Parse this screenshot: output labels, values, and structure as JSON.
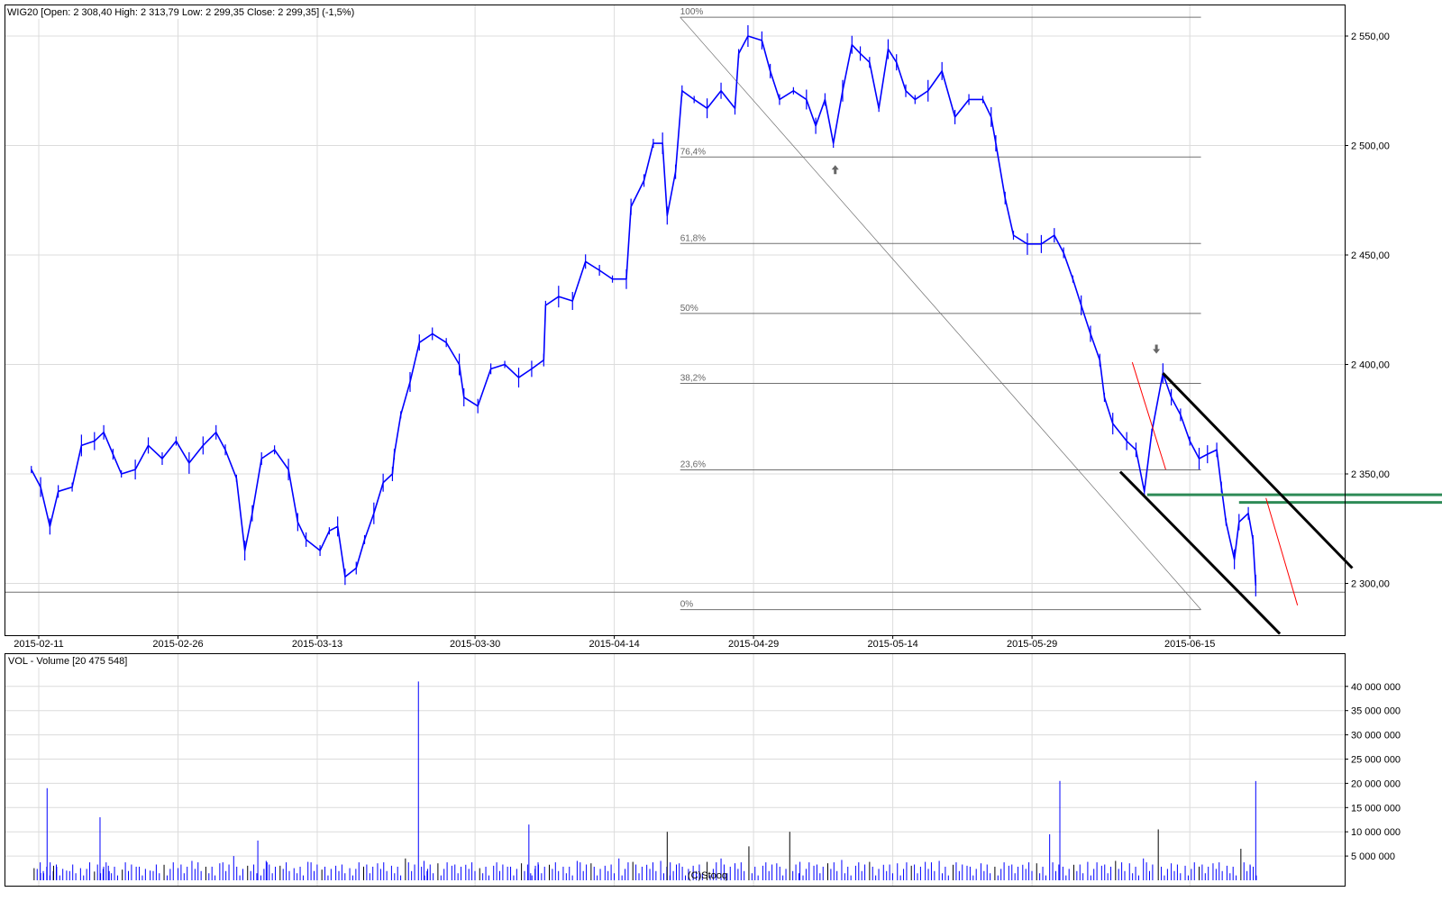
{
  "header": {
    "title": "WIG20 [Open: 2 308,40  High: 2 313,79  Low: 2 299,35  Close: 2 299,35] (-1,5%)"
  },
  "volume_header": {
    "title": "VOL - Volume [20 475 548]"
  },
  "footer": {
    "copyright": "(C)Stooq"
  },
  "colors": {
    "price": "#0000ff",
    "volume": "#0000ff",
    "grid": "#dcdcdc",
    "fib": "#707070",
    "channel": "#000000",
    "support": "#2e8b57",
    "trend": "#ff0000"
  },
  "chart_data": [
    {
      "type": "line",
      "title": "WIG20",
      "x_unit": "days since 2015-02-11",
      "xlim": [
        -3.7,
        140.7
      ],
      "ylim": [
        2281,
        2563
      ],
      "grid": true,
      "x_ticks": [
        {
          "day": 0,
          "label": "2015-02-11"
        },
        {
          "day": 15,
          "label": "2015-02-26"
        },
        {
          "day": 30,
          "label": "2015-03-13"
        },
        {
          "day": 47,
          "label": "2015-03-30"
        },
        {
          "day": 62,
          "label": "2015-04-14"
        },
        {
          "day": 77,
          "label": "2015-04-29"
        },
        {
          "day": 92,
          "label": "2015-05-14"
        },
        {
          "day": 107,
          "label": "2015-05-29"
        },
        {
          "day": 124,
          "label": "2015-06-15"
        }
      ],
      "y_ticks": [
        {
          "value": 2300,
          "label": "2 300,00"
        },
        {
          "value": 2350,
          "label": "2 350,00"
        },
        {
          "value": 2400,
          "label": "2 400,00"
        },
        {
          "value": 2450,
          "label": "2 450,00"
        },
        {
          "value": 2500,
          "label": "2 500,00"
        },
        {
          "value": 2550,
          "label": "2 550,00"
        }
      ],
      "series": [
        {
          "name": "WIG20",
          "days": [
            -0.8,
            0.2,
            1.2,
            2.1,
            3.6,
            4.6,
            6.0,
            7.0,
            8.0,
            8.9,
            10.4,
            11.8,
            13.3,
            14.8,
            16.2,
            17.7,
            19.1,
            20.1,
            21.3,
            22.2,
            23.0,
            24.0,
            25.4,
            26.9,
            27.9,
            28.8,
            30.3,
            31.3,
            32.2,
            33.0,
            34.2,
            35.1,
            36.1,
            37.1,
            38.1,
            38.3,
            39.0,
            40.0,
            41.0,
            42.4,
            43.9,
            45.3,
            45.8,
            47.3,
            48.7,
            50.2,
            51.7,
            53.1,
            54.4,
            54.6,
            56.0,
            57.5,
            58.9,
            60.4,
            61.8,
            63.3,
            63.8,
            65.2,
            66.2,
            67.2,
            67.7,
            68.6,
            69.3,
            70.6,
            72.0,
            73.5,
            75.0,
            75.4,
            76.4,
            77.9,
            78.8,
            79.8,
            81.3,
            82.7,
            83.7,
            84.7,
            85.6,
            86.6,
            87.6,
            88.5,
            89.5,
            90.5,
            91.5,
            92.4,
            93.4,
            94.4,
            95.8,
            97.3,
            98.7,
            100.2,
            101.7,
            102.6,
            103.1,
            104.1,
            105.0,
            106.5,
            108.0,
            109.4,
            110.4,
            111.4,
            112.3,
            113.3,
            114.3,
            114.8,
            115.7,
            117.2,
            118.2,
            119.1,
            119.9,
            121.1,
            122.0,
            123.0,
            124.0,
            125.0,
            125.9,
            126.9,
            127.4,
            127.9,
            128.8,
            129.3,
            130.3,
            130.8,
            131.1
          ],
          "values": [
            2352,
            2344,
            2326,
            2342,
            2344,
            2363,
            2365,
            2369,
            2359,
            2350,
            2352,
            2363,
            2357,
            2365,
            2355,
            2363,
            2369,
            2361,
            2348,
            2315,
            2332,
            2357,
            2361,
            2352,
            2328,
            2320,
            2315,
            2324,
            2326,
            2303,
            2307,
            2320,
            2332,
            2346,
            2350,
            2359,
            2377,
            2392,
            2410,
            2414,
            2410,
            2400,
            2385,
            2381,
            2398,
            2400,
            2394,
            2398,
            2402,
            2427,
            2431,
            2429,
            2447,
            2443,
            2439,
            2439,
            2472,
            2484,
            2501,
            2501,
            2468,
            2488,
            2525,
            2521,
            2517,
            2525,
            2517,
            2542,
            2550,
            2548,
            2534,
            2521,
            2525,
            2521,
            2509,
            2521,
            2501,
            2525,
            2546,
            2542,
            2538,
            2517,
            2544,
            2538,
            2525,
            2521,
            2525,
            2534,
            2513,
            2521,
            2521,
            2513,
            2501,
            2476,
            2459,
            2455,
            2455,
            2459,
            2451,
            2439,
            2427,
            2414,
            2402,
            2385,
            2373,
            2365,
            2361,
            2342,
            2369,
            2396,
            2385,
            2377,
            2365,
            2357,
            2359,
            2361,
            2344,
            2328,
            2311,
            2328,
            2332,
            2320,
            2299
          ]
        }
      ],
      "annotations": {
        "fibonacci": {
          "start_day": 69.1,
          "end_day": 125.2,
          "high": 2558.6,
          "low": 2288,
          "levels": [
            {
              "ratio": 1.0,
              "label": "100%"
            },
            {
              "ratio": 0.764,
              "label": "76,4%"
            },
            {
              "ratio": 0.618,
              "label": "61,8%"
            },
            {
              "ratio": 0.5,
              "label": "50%"
            },
            {
              "ratio": 0.382,
              "label": "38,2%"
            },
            {
              "ratio": 0.236,
              "label": "23,6%"
            },
            {
              "ratio": 0.0,
              "label": "0%"
            }
          ]
        },
        "horizontal_support": 2296,
        "green_levels": [
          {
            "from_day": 119.4,
            "price": 2340.5
          },
          {
            "from_day": 129.3,
            "price": 2337
          }
        ],
        "channel_lines": [
          {
            "from": [
              121.1,
              2396
            ],
            "to": [
              141.5,
              2307
            ]
          },
          {
            "from": [
              116.5,
              2351
            ],
            "to": [
              133.7,
              2277
            ]
          }
        ],
        "red_lines": [
          {
            "from": [
              117.8,
              2401
            ],
            "to": [
              121.4,
              2352
            ]
          },
          {
            "from": [
              132.2,
              2339
            ],
            "to": [
              135.6,
              2290
            ]
          }
        ],
        "arrows": [
          {
            "direction": "up",
            "day": 85.8,
            "price": 2489
          },
          {
            "direction": "down",
            "day": 120.4,
            "price": 2407
          }
        ]
      }
    },
    {
      "type": "bar",
      "title": "VOL - Volume",
      "ylim": [
        0,
        42000000
      ],
      "y_ticks": [
        {
          "value": 5000000,
          "label": "5 000 000"
        },
        {
          "value": 10000000,
          "label": "10 000 000"
        },
        {
          "value": 15000000,
          "label": "15 000 000"
        },
        {
          "value": 20000000,
          "label": "20 000 000"
        },
        {
          "value": 25000000,
          "label": "25 000 000"
        },
        {
          "value": 30000000,
          "label": "30 000 000"
        },
        {
          "value": 35000000,
          "label": "35 000 000"
        },
        {
          "value": 40000000,
          "label": "40 000 000"
        }
      ],
      "days": [
        -0.5,
        0.2,
        0.9,
        1.6,
        3,
        4.5,
        6,
        6.6,
        7.5,
        9,
        10.5,
        12,
        13.5,
        15,
        16.5,
        18,
        19.5,
        21,
        22.5,
        23.6,
        24.5,
        26,
        27.5,
        29,
        30.5,
        32,
        33.5,
        35,
        36.5,
        38,
        39.5,
        40.9,
        41.5,
        43,
        44.5,
        46,
        47.5,
        49,
        50.5,
        52,
        52.8,
        53.5,
        55,
        56.5,
        58,
        59.5,
        61,
        62.5,
        64,
        65.5,
        67,
        67.7,
        69,
        70.5,
        72,
        73.5,
        75,
        76.5,
        78,
        79.5,
        80.9,
        82,
        83.5,
        85,
        86.5,
        88,
        89.5,
        91,
        92.5,
        94,
        95.5,
        97,
        98.5,
        100,
        101.5,
        103,
        104.5,
        106,
        107.5,
        108.9,
        110,
        111.5,
        113,
        114.5,
        116,
        117.5,
        119,
        120.6,
        122,
        123.5,
        125,
        126.5,
        128,
        129.5,
        130.5,
        131.1
      ],
      "values": [
        2500000,
        1500000,
        19000000,
        3000000,
        2000000,
        2500000,
        1800000,
        13000000,
        3000000,
        2200000,
        2800000,
        2000000,
        3200000,
        2500000,
        4000000,
        2800000,
        3500000,
        5000000,
        3000000,
        8200000,
        4000000,
        3000000,
        2500000,
        3800000,
        2200000,
        3000000,
        2500000,
        2800000,
        3500000,
        3000000,
        4500000,
        41000000,
        4000000,
        3500000,
        3000000,
        3200000,
        2500000,
        3000000,
        2800000,
        3500000,
        11500000,
        3000000,
        3200000,
        2800000,
        4000000,
        3500000,
        3000000,
        4500000,
        3800000,
        3200000,
        4000000,
        10000000,
        3500000,
        3000000,
        3800000,
        4500000,
        3500000,
        7000000,
        3000000,
        3500000,
        10000000,
        3800000,
        3000000,
        3500000,
        4200000,
        3000000,
        3800000,
        3200000,
        3500000,
        3000000,
        3800000,
        4000000,
        3200000,
        3000000,
        3500000,
        2800000,
        3000000,
        3200000,
        3500000,
        9500000,
        20500000,
        3200000,
        3800000,
        3000000,
        4000000,
        3500000,
        4500000,
        10500000,
        3500000,
        3000000,
        2800000,
        3500000,
        3000000,
        6500000,
        3000000,
        20475548
      ]
    }
  ]
}
